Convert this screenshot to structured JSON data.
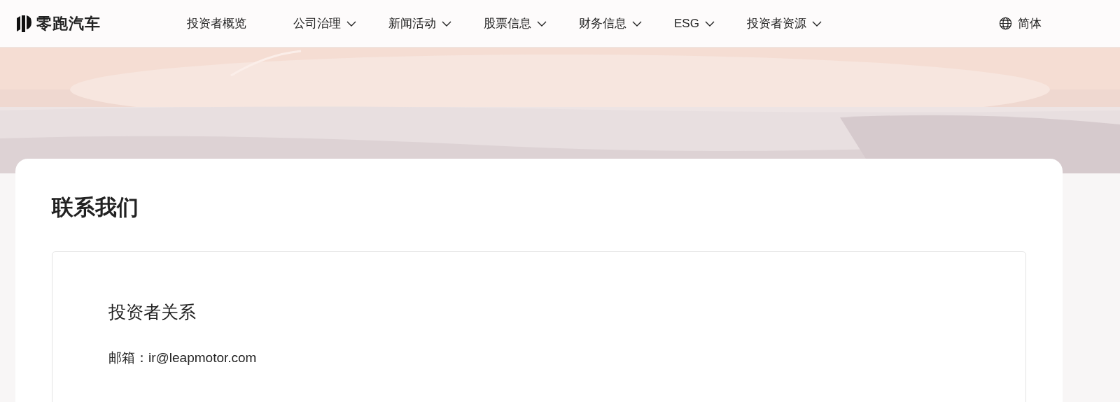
{
  "header": {
    "logo": "零跑汽车",
    "nav": [
      {
        "label": "投资者概览",
        "has_menu": false
      },
      {
        "label": "公司治理",
        "has_menu": true
      },
      {
        "label": "新闻活动",
        "has_menu": true
      },
      {
        "label": "股票信息",
        "has_menu": true
      },
      {
        "label": "财务信息",
        "has_menu": true
      },
      {
        "label": "ESG",
        "has_menu": true
      },
      {
        "label": "投资者资源",
        "has_menu": true
      }
    ],
    "language": "简体"
  },
  "contact": {
    "title": "联系我们",
    "section": {
      "heading": "投资者关系",
      "email_label": "邮箱：",
      "email": "ir@leapmotor.com"
    }
  }
}
